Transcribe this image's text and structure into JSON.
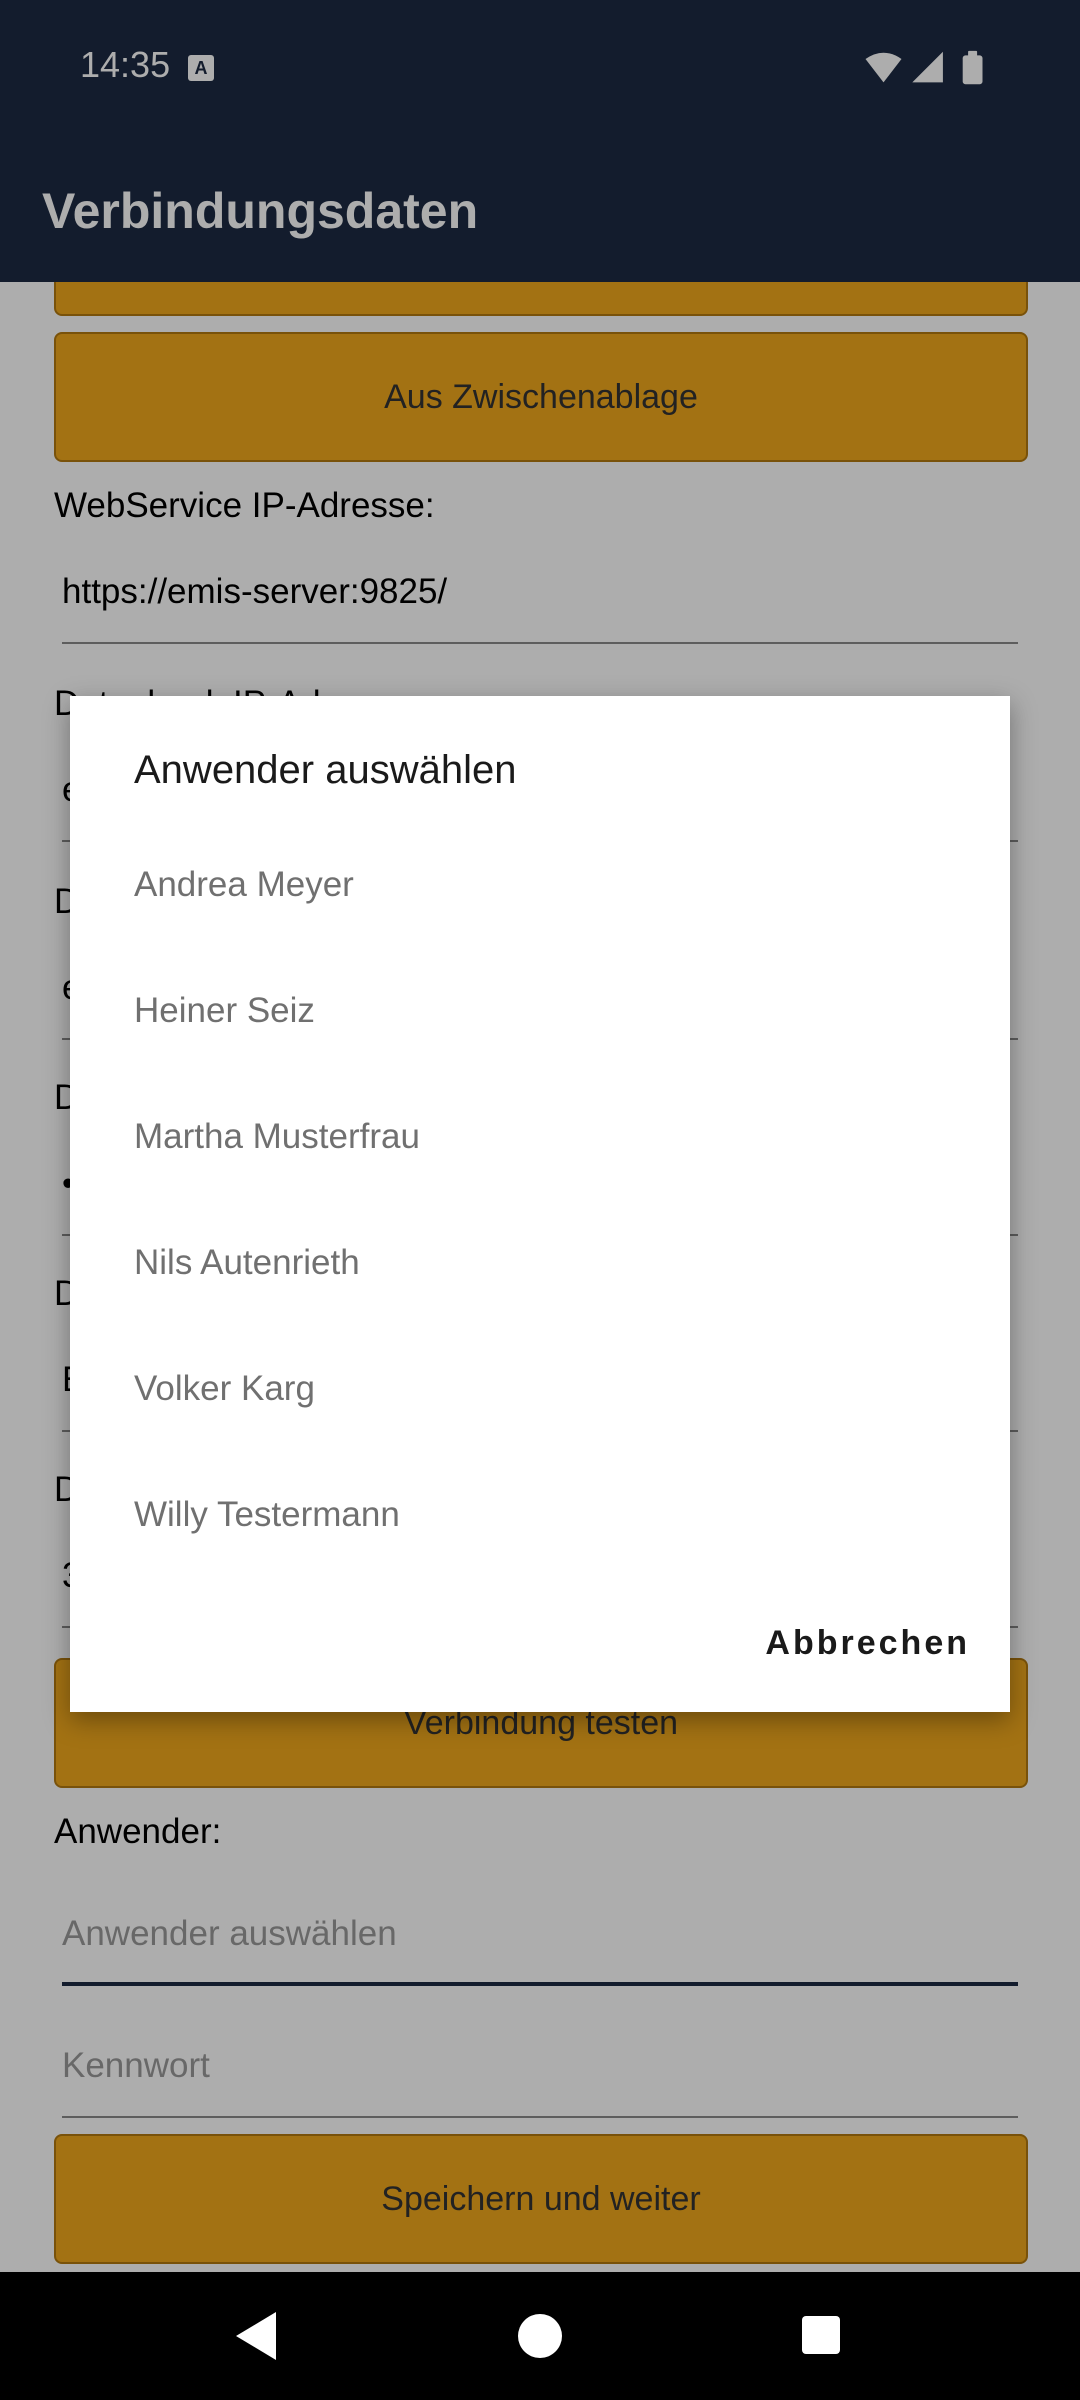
{
  "status_bar": {
    "time": "14:35",
    "notification_icon": "A",
    "icons": [
      "wifi-icon",
      "signal-icon",
      "battery-icon"
    ]
  },
  "app_bar": {
    "title": "Verbindungsdaten"
  },
  "form": {
    "clipboard_button": "Aus Zwischenablage",
    "webservice_label": "WebService IP-Adresse:",
    "webservice_value": "https://emis-server:9825/",
    "database_label_partial": "Datenbank IP-Adresse:",
    "obscured_field_initials": [
      "e",
      "e",
      "•",
      "E",
      "3"
    ],
    "obscured_label_initials": [
      "D",
      "D",
      "D",
      "D"
    ],
    "test_button": "Verbindung testen",
    "user_label": "Anwender:",
    "user_placeholder": "Anwender auswählen",
    "password_placeholder": "Kennwort",
    "save_button": "Speichern und weiter"
  },
  "dialog": {
    "title": "Anwender auswählen",
    "items": [
      "Andrea Meyer",
      "Heiner Seiz",
      "Martha Musterfrau",
      "Nils Autenrieth",
      "Volker Karg",
      "Willy Testermann"
    ],
    "cancel": "Abbrechen"
  },
  "colors": {
    "primary": "#1c2a43",
    "accent": "#f0a81c"
  },
  "navigation": [
    "back-icon",
    "home-icon",
    "recents-icon"
  ]
}
